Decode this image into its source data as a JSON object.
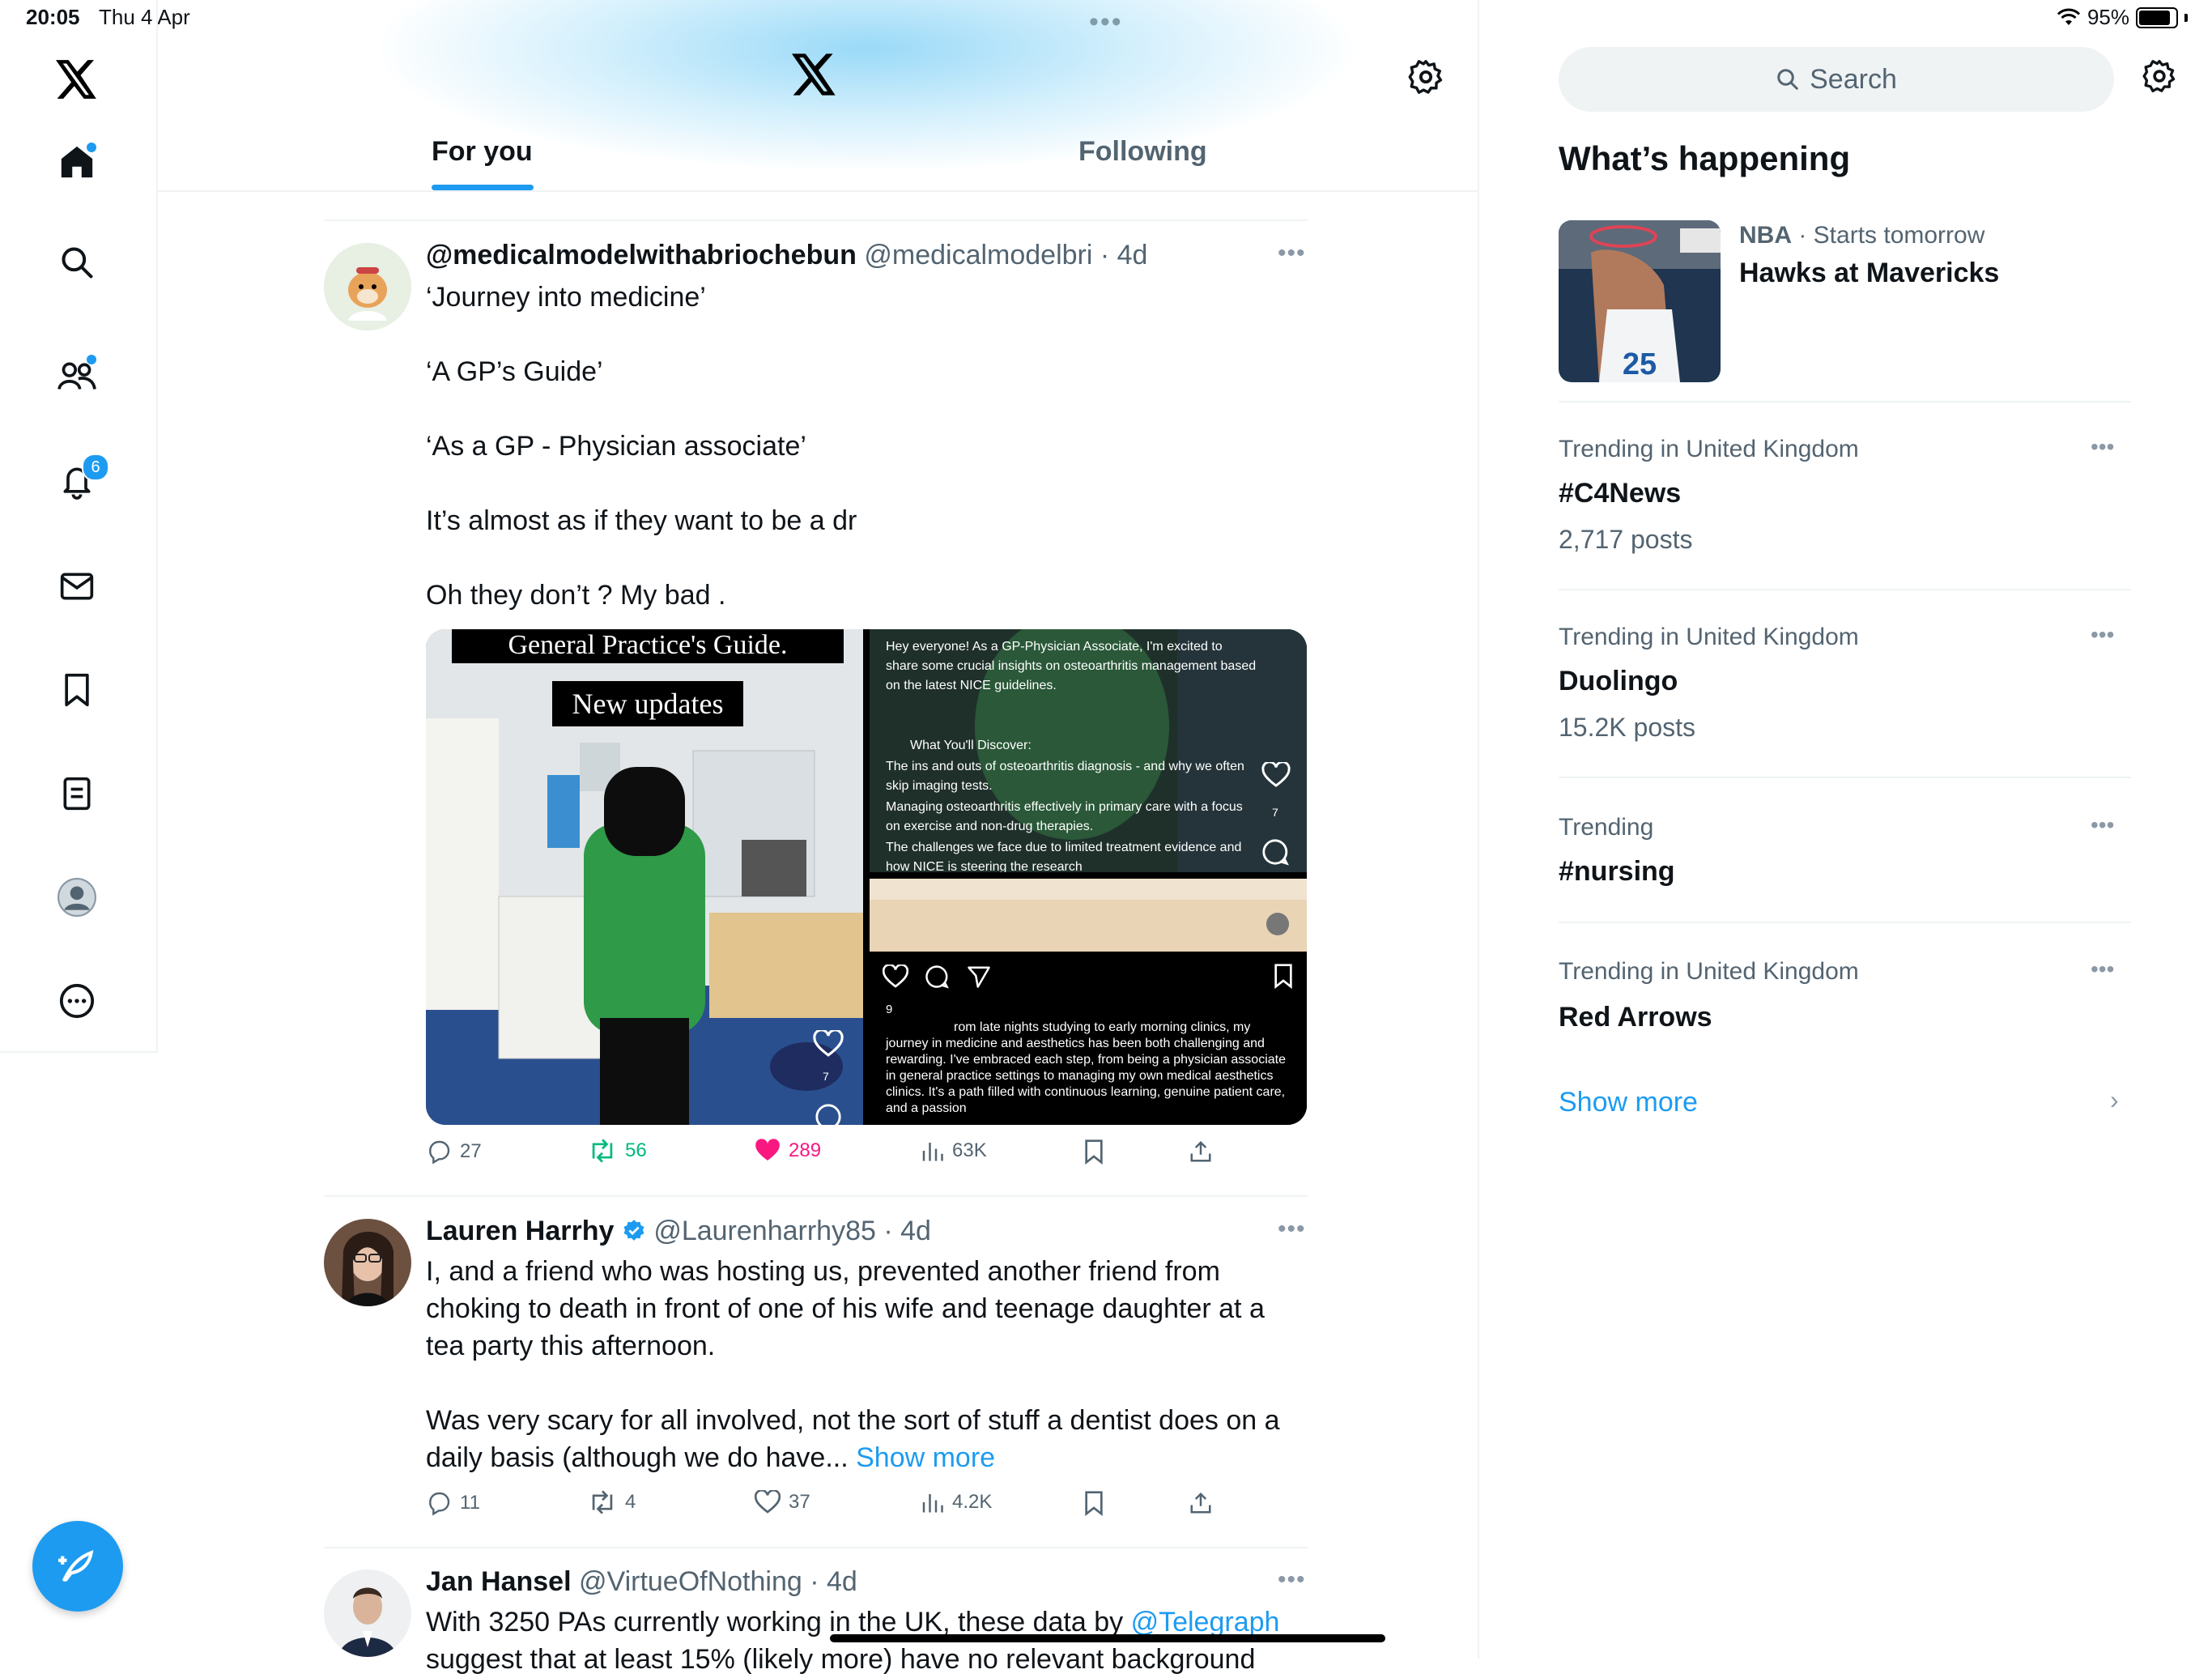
{
  "status_bar": {
    "time": "20:05",
    "date": "Thu 4 Apr",
    "battery": "95%",
    "battery_level": 0.95
  },
  "tabs": [
    {
      "label": "For you",
      "active": true
    },
    {
      "label": "Following",
      "active": false
    }
  ],
  "nav": {
    "notifications_badge": "6"
  },
  "tweets": [
    {
      "name": "@medicalmodelwithabriochebun",
      "handle": "@medicalmodelbri",
      "time": "4d",
      "paragraphs": [
        "‘Journey into medicine’",
        "‘A GP’s Guide’",
        "‘As a GP - Physician associate’",
        "It’s almost as if they want to be a dr",
        "Oh they don’t ? My bad ."
      ],
      "media": {
        "left_title": "General Practice's Guide.",
        "left_subtitle": "New updates",
        "left_like_count": "7",
        "tr_intro": "Hey everyone! As a GP-Physician Associate, I'm excited to share some crucial insights on osteoarthritis management based on the latest NICE guidelines.",
        "tr_heading": "What You'll Discover:",
        "tr_item1": "The ins and outs of osteoarthritis diagnosis - and why we often skip imaging tests.",
        "tr_item2": "Managing osteoarthritis effectively in primary care with a focus on exercise and non-drug therapies.",
        "tr_item3": "The challenges we face due to limited treatment evidence and how NICE is steering the research",
        "tr_like_count": "7",
        "br_count": "9",
        "br_caption": "rom late nights studying to early morning clinics, my journey in medicine and aesthetics has been both challenging and rewarding. I've embraced each step, from being a physician associate in general practice settings to managing my own medical aesthetics clinics. It's a path filled with continuous learning, genuine patient care, and a passion"
      },
      "replies": "27",
      "reposts": "56",
      "likes": "289",
      "views": "63K"
    },
    {
      "name": "Lauren Harrhy",
      "handle": "@Laurenharrhy85",
      "time": "4d",
      "text1": "I, and a friend who was hosting us, prevented another friend from choking to death in front of one of his wife and teenage daughter at a tea party this afternoon.",
      "text2": "Was very scary for all involved, not the sort of stuff a dentist does on a daily basis (although we do have...",
      "show_more": "Show more",
      "replies": "11",
      "reposts": "4",
      "likes": "37",
      "views": "4.2K"
    },
    {
      "name": "Jan Hansel",
      "handle": "@VirtueOfNothing",
      "time": "4d",
      "text": "With 3250 PAs currently working in the UK, these data by",
      "mention": "@Telegraph",
      "text_cut": "suggest that at least 15% (likely more) have no relevant background"
    }
  ],
  "sidebar": {
    "search_placeholder": "Search",
    "heading": "What’s happening",
    "event": {
      "league": "NBA",
      "when": "Starts tomorrow",
      "title": "Hawks at Mavericks"
    },
    "trends": [
      {
        "category": "Trending in United Kingdom",
        "title": "#C4News",
        "posts": "2,717 posts"
      },
      {
        "category": "Trending in United Kingdom",
        "title": "Duolingo",
        "posts": "15.2K posts"
      },
      {
        "category": "Trending",
        "title": "#nursing",
        "posts": ""
      },
      {
        "category": "Trending in United Kingdom",
        "title": "Red Arrows",
        "posts": ""
      }
    ],
    "show_more": "Show more"
  },
  "colors": {
    "accent": "#1d9bf0",
    "like": "#f91880",
    "repost": "#00ba7c",
    "secondary_text": "#536471"
  }
}
